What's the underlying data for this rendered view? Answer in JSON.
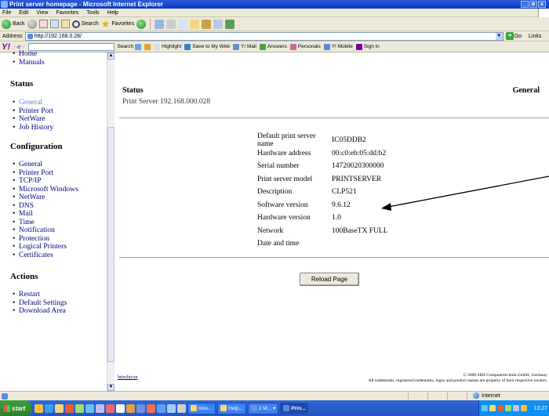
{
  "window": {
    "title": "Print server homepage - Microsoft Internet Explorer",
    "controls": [
      "_",
      "ø",
      "x"
    ]
  },
  "menu": [
    "File",
    "Edit",
    "View",
    "Favorites",
    "Tools",
    "Help"
  ],
  "toolbar": {
    "back_label": "Back",
    "search_label": "Search",
    "favorites_label": "Favorites"
  },
  "address": {
    "label": "Address",
    "value": "http://192.168.0.28/",
    "go_label": "Go",
    "links_label": "Links"
  },
  "yahoo": {
    "logo": "Y!",
    "search_label": "Search",
    "highlight_label": "Highlight",
    "save_label": "Save to My Web",
    "mail_label": "Y! Mail",
    "answers_label": "Answers",
    "personals_label": "Personals",
    "mobile_label": "Y! Mobile",
    "signin_label": "Sign in"
  },
  "sidebar": {
    "top_links": [
      "Home",
      "Manuals"
    ],
    "status_heading": "Status",
    "status_links": [
      "General",
      "Printer Port",
      "NetWare",
      "Job History"
    ],
    "config_heading": "Configuration",
    "config_links": [
      "General",
      "Printer Port",
      "TCP/IP",
      "Microsoft Windows",
      "NetWare",
      "DNS",
      "Mail",
      "Time",
      "Notification",
      "Protection",
      "Logical Printers",
      "Certificates"
    ],
    "actions_heading": "Actions",
    "action_links": [
      "Restart",
      "Default Settings",
      "Download Area"
    ]
  },
  "main": {
    "title": "Status",
    "subtitle": "Print Server 192.168.000.028",
    "section": "General",
    "rows": [
      {
        "label": "Default print server name",
        "value": "IC05DDB2"
      },
      {
        "label": "Hardware address",
        "value": "00:c0:eb:05:dd:b2"
      },
      {
        "label": "Serial number",
        "value": "14720020300000"
      },
      {
        "label": "Print server model",
        "value": "PRINTSERVER"
      },
      {
        "label": "Description",
        "value": "CLP521"
      },
      {
        "label": "Software version",
        "value": "9.6.12"
      },
      {
        "label": "Hardware version",
        "value": "1.0"
      },
      {
        "label": "Network",
        "value": "100BaseTX FULL"
      },
      {
        "label": "Date and time",
        "value": ""
      }
    ],
    "reload_label": "Reload Page",
    "footer_link": "brtechicon",
    "footer_copy1": "© 2006 SEH Computertechnik GmbH, Germany",
    "footer_copy2": "All trademarks, registered trademarks, logos and product names are property of their respective owners."
  },
  "statusbar": {
    "zone": "Internet"
  },
  "taskbar": {
    "start_label": "start",
    "tasks": [
      "Inbo...",
      "Help...",
      "2 M...",
      "Prin..."
    ],
    "clock": "13:27"
  },
  "colors": {
    "titlebar": "#0a3bc0",
    "link": "#00007b",
    "active_link": "#6b7fd4",
    "taskbar": "#2454c4"
  }
}
